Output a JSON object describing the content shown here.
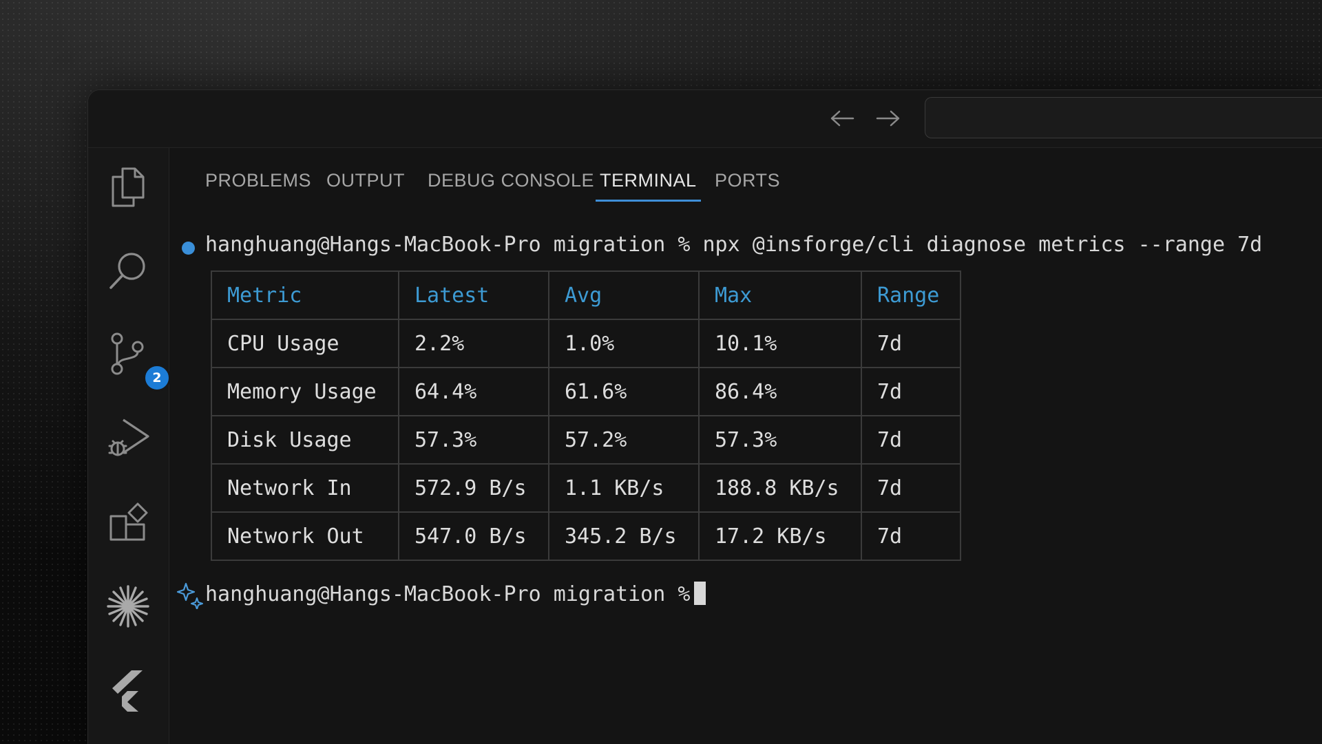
{
  "panel": {
    "tabs": [
      "PROBLEMS",
      "OUTPUT",
      "DEBUG CONSOLE",
      "TERMINAL",
      "PORTS"
    ],
    "active_tab": "TERMINAL"
  },
  "activity_bar": {
    "icons": [
      "files-icon",
      "search-icon",
      "source-control-icon",
      "run-debug-icon",
      "extensions-icon",
      "sparkle-burst-icon",
      "flutter-icon"
    ],
    "source_control_badge": "2"
  },
  "terminal": {
    "prompt": "hanghuang@Hangs-MacBook-Pro migration %",
    "command": "npx @insforge/cli diagnose metrics --range 7d",
    "second_prompt": "hanghuang@Hangs-MacBook-Pro migration %",
    "table": {
      "headers": [
        "Metric",
        "Latest",
        "Avg",
        "Max",
        "Range"
      ],
      "rows": [
        [
          "CPU Usage",
          "2.2%",
          "1.0%",
          "10.1%",
          "7d"
        ],
        [
          "Memory Usage",
          "64.4%",
          "61.6%",
          "86.4%",
          "7d"
        ],
        [
          "Disk Usage",
          "57.3%",
          "57.2%",
          "57.3%",
          "7d"
        ],
        [
          "Network In",
          "572.9 B/s",
          "1.1 KB/s",
          "188.8 KB/s",
          "7d"
        ],
        [
          "Network Out",
          "547.0 B/s",
          "345.2 B/s",
          "17.2 KB/s",
          "7d"
        ]
      ]
    }
  },
  "colors": {
    "accent": "#3f8fd8",
    "header_text": "#3d9bd4",
    "badge": "#1c7cd6"
  }
}
